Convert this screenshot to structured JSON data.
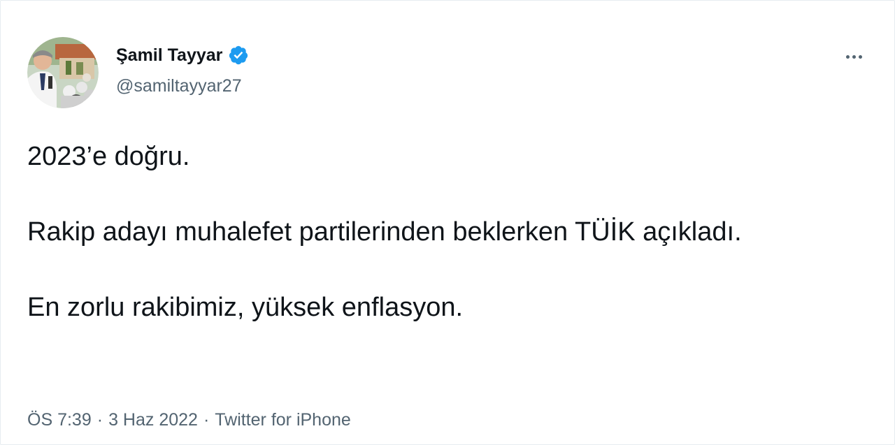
{
  "author": {
    "display_name": "Şamil Tayyar",
    "handle": "@samiltayyar27",
    "verified": true,
    "verified_icon": "verified-badge-icon",
    "avatar_icon": "profile-photo"
  },
  "menu": {
    "more_icon": "more-dots-icon"
  },
  "tweet": {
    "paragraphs": [
      "2023’e doğru.",
      "Rakip adayı muhalefet partilerinden beklerken TÜİK açıkladı.",
      "En zorlu rakibimiz, yüksek enflasyon."
    ]
  },
  "meta": {
    "time": "ÖS 7:39",
    "separator": "·",
    "date": "3 Haz 2022",
    "source": "Twitter for iPhone"
  },
  "colors": {
    "text_primary": "#0f1419",
    "text_secondary": "#536471",
    "verified_blue": "#1d9bf0",
    "border": "#e6ecf0"
  }
}
